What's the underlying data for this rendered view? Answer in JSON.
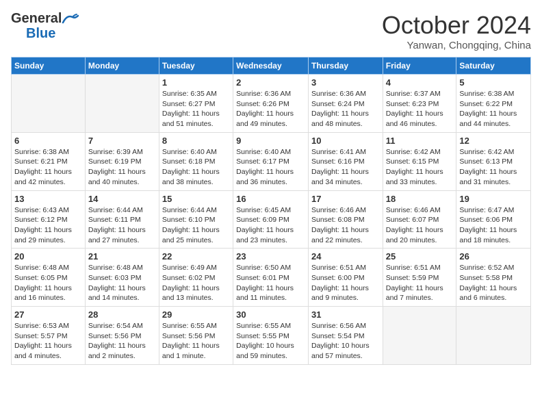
{
  "header": {
    "logo_general": "General",
    "logo_blue": "Blue",
    "month_title": "October 2024",
    "subtitle": "Yanwan, Chongqing, China"
  },
  "weekdays": [
    "Sunday",
    "Monday",
    "Tuesday",
    "Wednesday",
    "Thursday",
    "Friday",
    "Saturday"
  ],
  "weeks": [
    [
      {
        "day": "",
        "info": ""
      },
      {
        "day": "",
        "info": ""
      },
      {
        "day": "1",
        "info": "Sunrise: 6:35 AM\nSunset: 6:27 PM\nDaylight: 11 hours\nand 51 minutes."
      },
      {
        "day": "2",
        "info": "Sunrise: 6:36 AM\nSunset: 6:26 PM\nDaylight: 11 hours\nand 49 minutes."
      },
      {
        "day": "3",
        "info": "Sunrise: 6:36 AM\nSunset: 6:24 PM\nDaylight: 11 hours\nand 48 minutes."
      },
      {
        "day": "4",
        "info": "Sunrise: 6:37 AM\nSunset: 6:23 PM\nDaylight: 11 hours\nand 46 minutes."
      },
      {
        "day": "5",
        "info": "Sunrise: 6:38 AM\nSunset: 6:22 PM\nDaylight: 11 hours\nand 44 minutes."
      }
    ],
    [
      {
        "day": "6",
        "info": "Sunrise: 6:38 AM\nSunset: 6:21 PM\nDaylight: 11 hours\nand 42 minutes."
      },
      {
        "day": "7",
        "info": "Sunrise: 6:39 AM\nSunset: 6:19 PM\nDaylight: 11 hours\nand 40 minutes."
      },
      {
        "day": "8",
        "info": "Sunrise: 6:40 AM\nSunset: 6:18 PM\nDaylight: 11 hours\nand 38 minutes."
      },
      {
        "day": "9",
        "info": "Sunrise: 6:40 AM\nSunset: 6:17 PM\nDaylight: 11 hours\nand 36 minutes."
      },
      {
        "day": "10",
        "info": "Sunrise: 6:41 AM\nSunset: 6:16 PM\nDaylight: 11 hours\nand 34 minutes."
      },
      {
        "day": "11",
        "info": "Sunrise: 6:42 AM\nSunset: 6:15 PM\nDaylight: 11 hours\nand 33 minutes."
      },
      {
        "day": "12",
        "info": "Sunrise: 6:42 AM\nSunset: 6:13 PM\nDaylight: 11 hours\nand 31 minutes."
      }
    ],
    [
      {
        "day": "13",
        "info": "Sunrise: 6:43 AM\nSunset: 6:12 PM\nDaylight: 11 hours\nand 29 minutes."
      },
      {
        "day": "14",
        "info": "Sunrise: 6:44 AM\nSunset: 6:11 PM\nDaylight: 11 hours\nand 27 minutes."
      },
      {
        "day": "15",
        "info": "Sunrise: 6:44 AM\nSunset: 6:10 PM\nDaylight: 11 hours\nand 25 minutes."
      },
      {
        "day": "16",
        "info": "Sunrise: 6:45 AM\nSunset: 6:09 PM\nDaylight: 11 hours\nand 23 minutes."
      },
      {
        "day": "17",
        "info": "Sunrise: 6:46 AM\nSunset: 6:08 PM\nDaylight: 11 hours\nand 22 minutes."
      },
      {
        "day": "18",
        "info": "Sunrise: 6:46 AM\nSunset: 6:07 PM\nDaylight: 11 hours\nand 20 minutes."
      },
      {
        "day": "19",
        "info": "Sunrise: 6:47 AM\nSunset: 6:06 PM\nDaylight: 11 hours\nand 18 minutes."
      }
    ],
    [
      {
        "day": "20",
        "info": "Sunrise: 6:48 AM\nSunset: 6:05 PM\nDaylight: 11 hours\nand 16 minutes."
      },
      {
        "day": "21",
        "info": "Sunrise: 6:48 AM\nSunset: 6:03 PM\nDaylight: 11 hours\nand 14 minutes."
      },
      {
        "day": "22",
        "info": "Sunrise: 6:49 AM\nSunset: 6:02 PM\nDaylight: 11 hours\nand 13 minutes."
      },
      {
        "day": "23",
        "info": "Sunrise: 6:50 AM\nSunset: 6:01 PM\nDaylight: 11 hours\nand 11 minutes."
      },
      {
        "day": "24",
        "info": "Sunrise: 6:51 AM\nSunset: 6:00 PM\nDaylight: 11 hours\nand 9 minutes."
      },
      {
        "day": "25",
        "info": "Sunrise: 6:51 AM\nSunset: 5:59 PM\nDaylight: 11 hours\nand 7 minutes."
      },
      {
        "day": "26",
        "info": "Sunrise: 6:52 AM\nSunset: 5:58 PM\nDaylight: 11 hours\nand 6 minutes."
      }
    ],
    [
      {
        "day": "27",
        "info": "Sunrise: 6:53 AM\nSunset: 5:57 PM\nDaylight: 11 hours\nand 4 minutes."
      },
      {
        "day": "28",
        "info": "Sunrise: 6:54 AM\nSunset: 5:56 PM\nDaylight: 11 hours\nand 2 minutes."
      },
      {
        "day": "29",
        "info": "Sunrise: 6:55 AM\nSunset: 5:56 PM\nDaylight: 11 hours\nand 1 minute."
      },
      {
        "day": "30",
        "info": "Sunrise: 6:55 AM\nSunset: 5:55 PM\nDaylight: 10 hours\nand 59 minutes."
      },
      {
        "day": "31",
        "info": "Sunrise: 6:56 AM\nSunset: 5:54 PM\nDaylight: 10 hours\nand 57 minutes."
      },
      {
        "day": "",
        "info": ""
      },
      {
        "day": "",
        "info": ""
      }
    ]
  ]
}
